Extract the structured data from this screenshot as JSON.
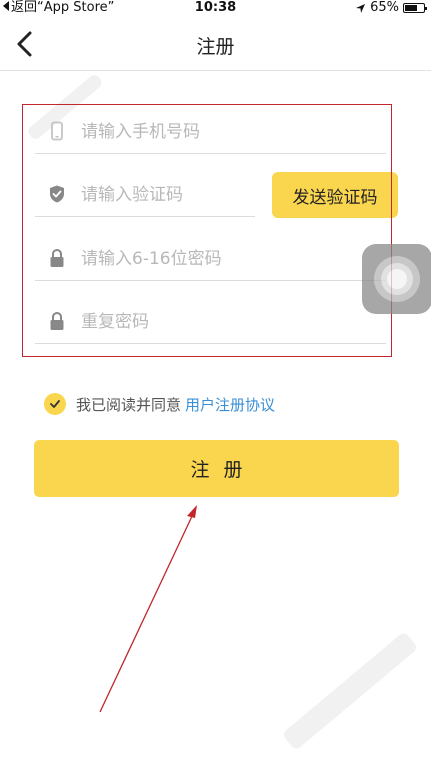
{
  "status_bar": {
    "back_app": "返回“App Store”",
    "time": "10:38",
    "battery_percent": "65%",
    "battery_level": 0.65
  },
  "nav": {
    "title": "注册"
  },
  "form": {
    "phone_placeholder": "请输入手机号码",
    "code_placeholder": "请输入验证码",
    "send_code_label": "发送验证码",
    "password_placeholder": "请输入6-16位密码",
    "repeat_password_placeholder": "重复密码"
  },
  "agreement": {
    "text": "我已阅读并同意",
    "link": "用户注册协议",
    "checked": true
  },
  "register_button": {
    "label": "注册"
  },
  "colors": {
    "accent": "#fad64f",
    "link": "#3a8fd6",
    "annotation": "#c0262b"
  }
}
